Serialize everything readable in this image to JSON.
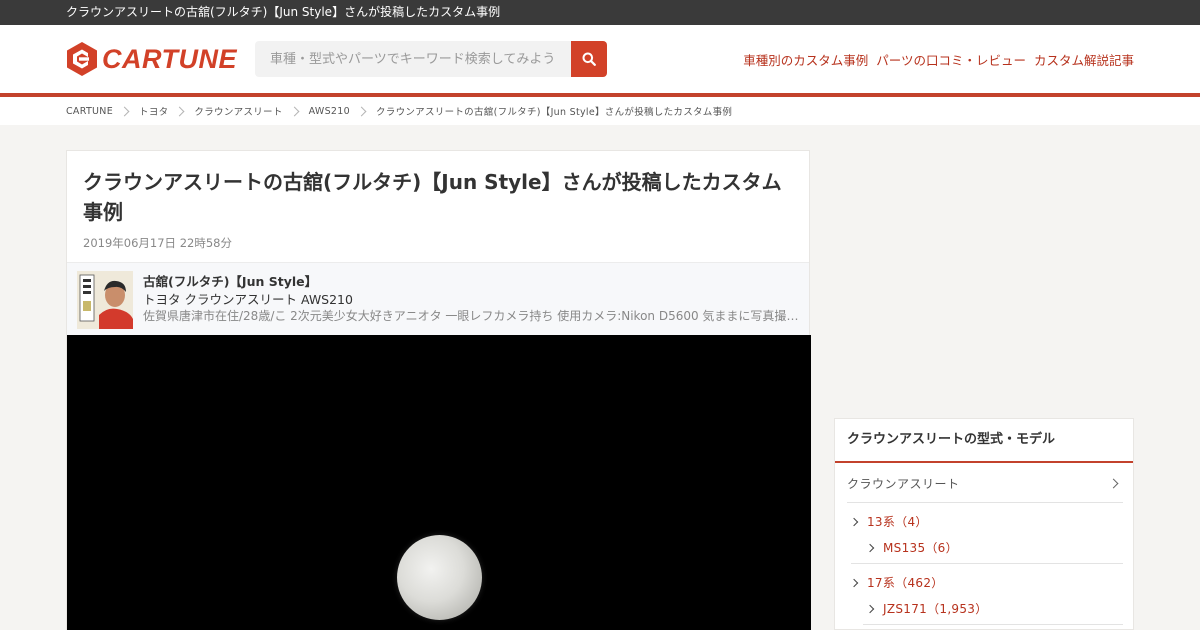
{
  "topbar": {
    "text": "クラウンアスリートの古舘(フルタチ)【Jun Style】さんが投稿したカスタム事例"
  },
  "header": {
    "logo_text": "CARTUNE",
    "search_placeholder": "車種・型式やパーツでキーワード検索してみよう",
    "nav": [
      "車種別のカスタム事例",
      "パーツの口コミ・レビュー",
      "カスタム解説記事"
    ]
  },
  "breadcrumb": [
    "CARTUNE",
    "トヨタ",
    "クラウンアスリート",
    "AWS210",
    "クラウンアスリートの古舘(フルタチ)【Jun Style】さんが投稿したカスタム事例"
  ],
  "post": {
    "title": "クラウンアスリートの古舘(フルタチ)【Jun Style】さんが投稿したカスタム事例",
    "date": "2019年06月17日 22時58分",
    "user": {
      "name": "古舘(フルタチ)【Jun Style】",
      "car": "トヨタ クラウンアスリート AWS210",
      "description": "佐賀県唐津市在住/28歳/こ 2次元美少女大好きアニオタ 一眼レフカメラ持ち 使用カメラ:Nikon D5600 気ままに写真撮ってます"
    }
  },
  "sidebar": {
    "title": "クラウンアスリートの型式・モデル",
    "model": "クラウンアスリート",
    "tree": [
      {
        "label": "13系（4）",
        "children": [
          "MS135（6）"
        ]
      },
      {
        "label": "17系（462）",
        "children": [
          "JZS171（1,953）"
        ]
      }
    ]
  },
  "colors": {
    "accent": "#d24128",
    "link": "#b7321d",
    "topbar": "#3a3a3a"
  }
}
